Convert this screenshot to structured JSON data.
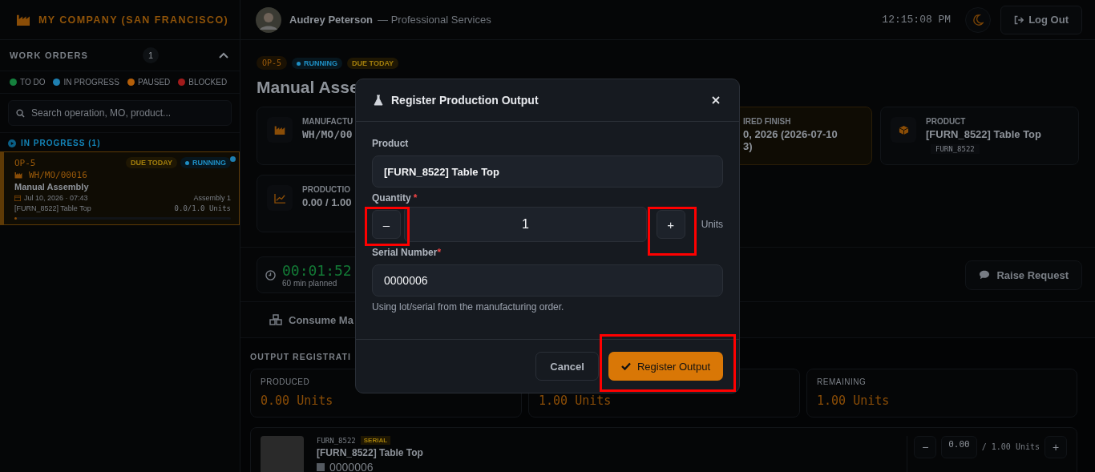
{
  "header": {
    "company": "MY COMPANY (SAN FRANCISCO)",
    "user": "Audrey Peterson",
    "role": "— Professional Services",
    "clock": "12:15:08 PM",
    "logout": "Log Out"
  },
  "sidebar": {
    "title": "WORK ORDERS",
    "count": "1",
    "expanded": true,
    "legend": [
      {
        "label": "TO DO",
        "color": "#15803d"
      },
      {
        "label": "IN PROGRESS",
        "color": "#1e7fb0"
      },
      {
        "label": "PAUSED",
        "color": "#b45f09"
      },
      {
        "label": "BLOCKED",
        "color": "#a11b1b"
      }
    ],
    "search": {
      "placeholder": "Search operation, MO, product..."
    },
    "section": "IN PROGRESS (1)",
    "orders": [
      {
        "op": "OP-5",
        "badges": [
          {
            "label": "DUE TODAY",
            "kind": "due"
          },
          {
            "label": "RUNNING",
            "kind": "running"
          }
        ],
        "mo": "WH/MO/00016",
        "name": "Manual Assembly",
        "date": "Jul 10, 2026 · 07:43",
        "workcenter": "Assembly 1",
        "product": "[FURN_8522] Table Top",
        "qty": "0.0/1.0 Units",
        "level": 0,
        "selected": true
      }
    ]
  },
  "operation": {
    "op": "OP-5",
    "badges": [
      {
        "label": "RUNNING",
        "kind": "running"
      },
      {
        "label": "DUE TODAY",
        "kind": "due"
      }
    ],
    "title": "Manual Asse",
    "cards": [
      {
        "kind": "mo",
        "label": "MANUFACTU",
        "value": "WH/MO/00"
      },
      {
        "kind": "finish",
        "label": "IRED FINISH",
        "value": "0, 2026 (2026-07-10\n3)"
      },
      {
        "kind": "product",
        "label": "PRODUCT",
        "value": "[FURN_8522] Table Top",
        "code": "FURN_8522"
      },
      {
        "kind": "progress",
        "label": "PRODUCTIO",
        "value": "0.00 / 1.00"
      }
    ],
    "timer": {
      "time": "00:01:52",
      "planned": "60 min planned"
    },
    "raise_request": "Raise Request",
    "tabs": [
      {
        "label": "Consume Ma"
      }
    ]
  },
  "output": {
    "title": "OUTPUT REGISTRATI",
    "stats": [
      {
        "label": "PRODUCED",
        "value": "0.00 Units"
      },
      {
        "value": "1.00 Units"
      },
      {
        "label": "REMAINING",
        "value": "1.00 Units"
      }
    ],
    "line": {
      "code": "FURN_8522",
      "tag": "SERIAL",
      "name": "[FURN_8522] Table Top",
      "serial": "0000006",
      "decrement": "−",
      "qty": "0.00",
      "total": "/ 1.00 Units",
      "increment": "+"
    }
  },
  "modal": {
    "title": "Register Production Output",
    "product_label": "Product",
    "product": "[FURN_8522] Table Top",
    "quantity_label": "Quantity",
    "quantity_mark": "*",
    "quantity": "1",
    "unit": "Units",
    "serial_label": "Serial Number",
    "serial_mark": "*",
    "serial": "0000006",
    "hint": "Using lot/serial from the manufacturing order.",
    "decrement": {
      "label": "–",
      "highlighted": true
    },
    "increment": {
      "label": "+",
      "highlighted": true
    },
    "cancel": {
      "label": "Cancel"
    },
    "submit": {
      "label": "Register Output",
      "highlighted": true
    }
  }
}
